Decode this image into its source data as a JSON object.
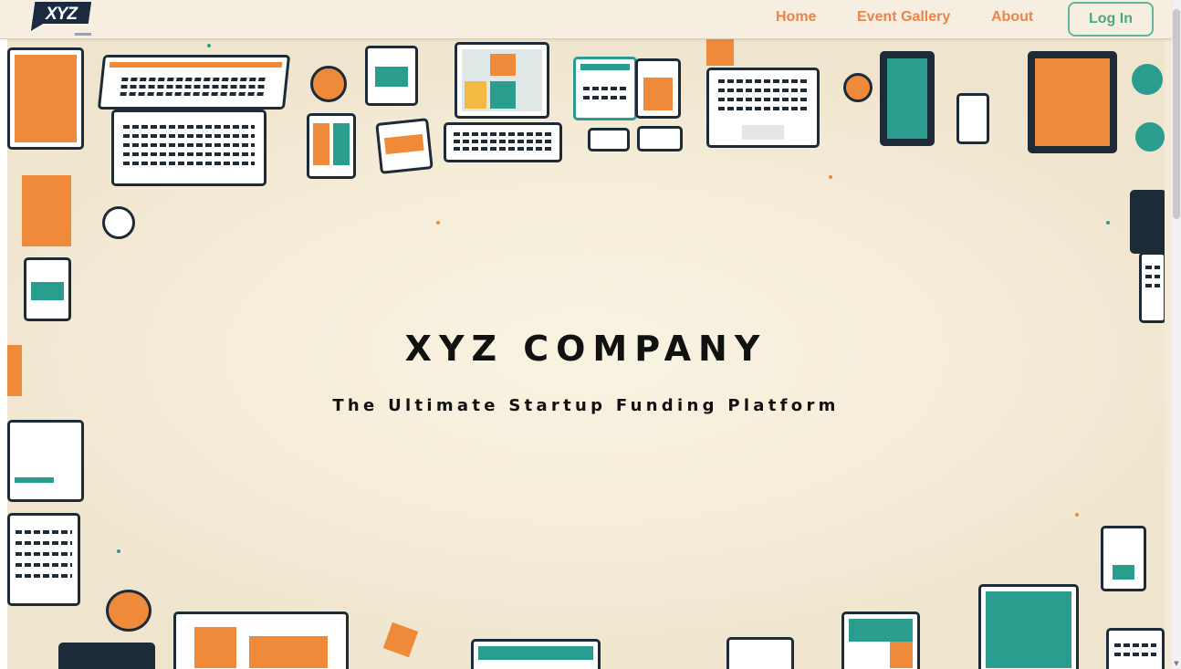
{
  "header": {
    "logo_text": "XYZ",
    "nav": {
      "home": "Home",
      "event_gallery": "Event Gallery",
      "about": "About"
    },
    "login_label": "Log In"
  },
  "hero": {
    "title": "XYZ COMPANY",
    "subtitle": "The Ultimate Startup Funding Platform",
    "illustration": "illustration of laptops, tablets and phones around the edges"
  },
  "colors": {
    "accent_orange": "#ee8a3a",
    "accent_teal": "#2a9d8f",
    "navy": "#1d2a38",
    "background": "#f3ead8",
    "login_border": "#5fb69c"
  }
}
